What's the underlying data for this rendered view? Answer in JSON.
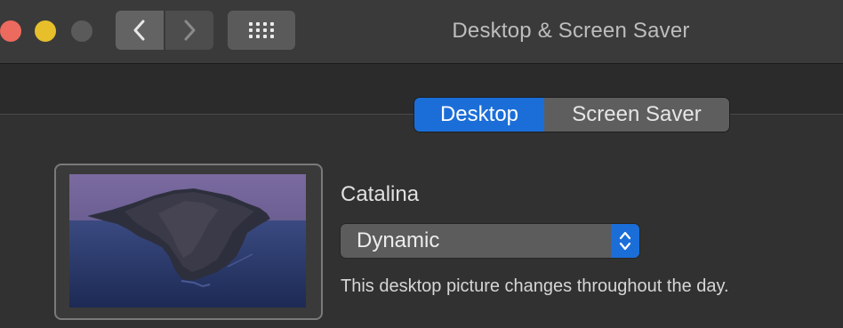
{
  "window": {
    "title": "Desktop & Screen Saver"
  },
  "toolbar": {
    "back_icon": "chevron-left-icon",
    "forward_icon": "chevron-right-icon",
    "show_all_icon": "grid-icon"
  },
  "tabs": [
    {
      "label": "Desktop",
      "selected": true
    },
    {
      "label": "Screen Saver",
      "selected": false
    }
  ],
  "desktop": {
    "picture_name": "Catalina",
    "mode_popup": {
      "selected": "Dynamic"
    },
    "description": "This desktop picture changes throughout the day."
  },
  "colors": {
    "accent": "#1b6ed8",
    "close": "#ed6a5e",
    "minimize": "#e6bf2b",
    "zoom_disabled": "#5a5a5a"
  }
}
